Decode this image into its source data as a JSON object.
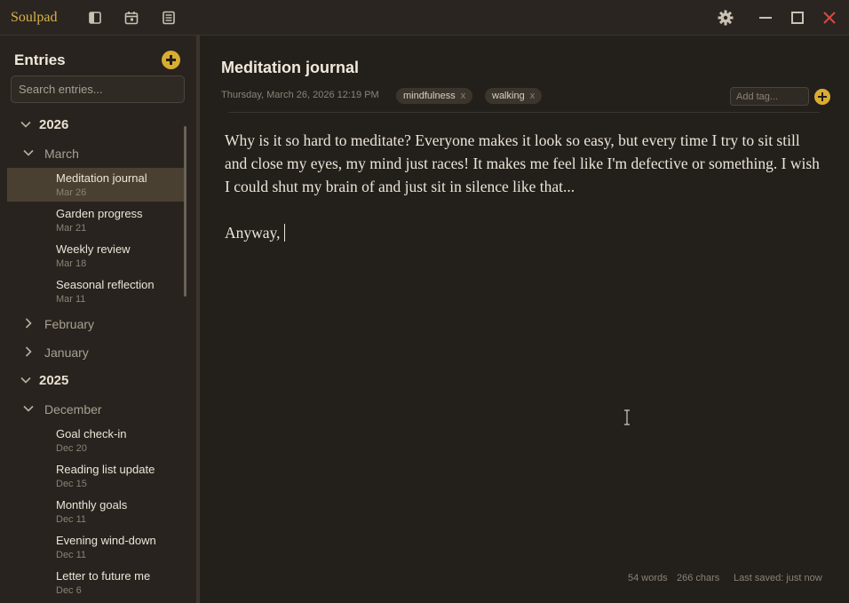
{
  "app": {
    "name": "Soulpad"
  },
  "sidebar": {
    "title": "Entries",
    "search_placeholder": "Search entries...",
    "years": [
      {
        "label": "2026",
        "months": [
          {
            "label": "March",
            "entries": [
              {
                "title": "Meditation journal",
                "date": "Mar 26"
              },
              {
                "title": "Garden progress",
                "date": "Mar 21"
              },
              {
                "title": "Weekly review",
                "date": "Mar 18"
              },
              {
                "title": "Seasonal reflection",
                "date": "Mar 11"
              }
            ]
          },
          {
            "label": "February"
          },
          {
            "label": "January"
          }
        ]
      },
      {
        "label": "2025",
        "months": [
          {
            "label": "December",
            "entries": [
              {
                "title": "Goal check-in",
                "date": "Dec 20"
              },
              {
                "title": "Reading list update",
                "date": "Dec 15"
              },
              {
                "title": "Monthly goals",
                "date": "Dec 11"
              },
              {
                "title": "Evening wind-down",
                "date": "Dec 11"
              },
              {
                "title": "Letter to future me",
                "date": "Dec 6"
              }
            ]
          }
        ]
      }
    ]
  },
  "entry": {
    "title": "Meditation journal",
    "datetime": "Thursday, March 26, 2026 12:19 PM",
    "tags": [
      {
        "label": "mindfulness",
        "remove": "x"
      },
      {
        "label": "walking",
        "remove": "x"
      }
    ],
    "tag_placeholder": "Add tag...",
    "body": [
      "Why is it so hard to meditate? Everyone makes it look so easy, but every time I try to sit still and close my eyes, my mind just races! It makes me feel like I'm defective or something. I wish I could shut my brain of and just sit in silence like that...",
      "Anyway,"
    ]
  },
  "status": {
    "words": "54 words",
    "chars": "266 chars",
    "saved": "Last saved: just now"
  },
  "colors": {
    "accent": "#d9ac32",
    "close": "#e0453f",
    "background": "#231f1b",
    "sidebar": "#28231e",
    "selected": "#4a4032"
  },
  "icons": [
    "sidebar-toggle-icon",
    "calendar-icon",
    "stack-icon",
    "gear-icon",
    "minimize-icon",
    "maximize-icon",
    "close-icon"
  ]
}
